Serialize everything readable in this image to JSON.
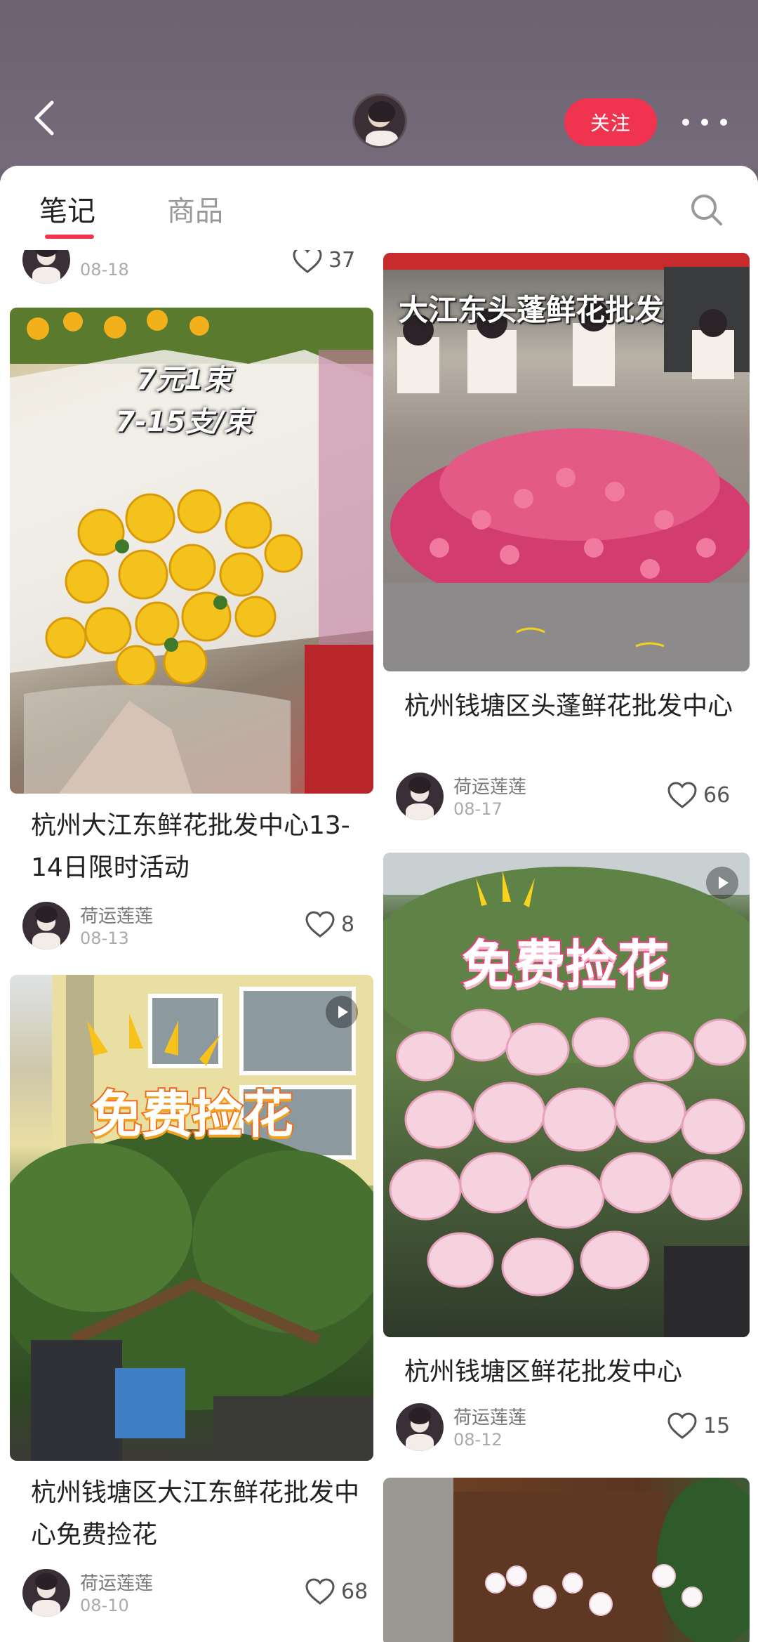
{
  "header": {
    "follow_label": "关注",
    "back_icon": "chevron-left-icon",
    "more_icon": "more-dots-icon"
  },
  "tabs": [
    {
      "label": "笔记",
      "active": true
    },
    {
      "label": "商品",
      "active": false
    }
  ],
  "colors": {
    "accent": "#f0344f"
  },
  "partial_card": {
    "date": "08-18",
    "likes": "37"
  },
  "cards": [
    {
      "title": "杭州大江东鲜花批发中心13-14日限时活动",
      "overlay": [
        "7元1束",
        "7-15支/束"
      ],
      "author": "荷运莲莲",
      "date": "08-13",
      "likes": "8"
    },
    {
      "title": "杭州钱塘区头蓬鲜花批发中心",
      "overlay": [
        "大江东头蓬鲜花批发"
      ],
      "author": "荷运莲莲",
      "date": "08-17",
      "likes": "66"
    },
    {
      "title": "杭州钱塘区鲜花批发中心",
      "overlay": [
        "免费捡花"
      ],
      "author": "荷运莲莲",
      "date": "08-12",
      "likes": "15"
    },
    {
      "title": "杭州钱塘区大江东鲜花批发中心免费捡花",
      "overlay": [
        "免费捡花"
      ],
      "author": "荷运莲莲",
      "date": "08-10",
      "likes": "68"
    }
  ]
}
